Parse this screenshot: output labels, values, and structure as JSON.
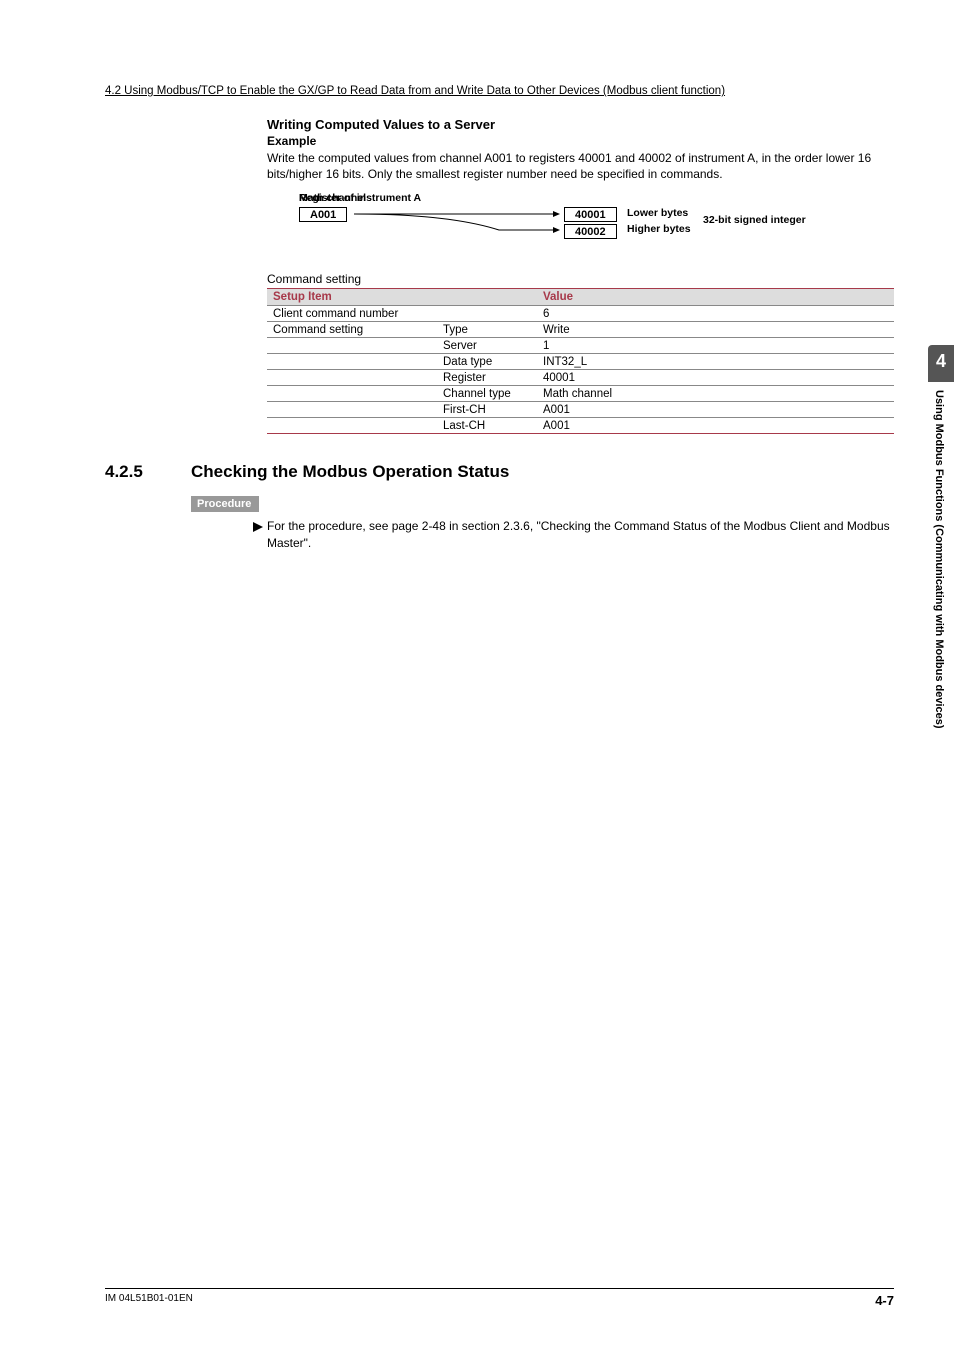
{
  "header_line": "4.2  Using Modbus/TCP to Enable the GX/GP to Read Data from and Write Data to Other Devices (Modbus client function)",
  "sub1": "Writing Computed Values to a Server",
  "sub2": "Example",
  "para": "Write the computed values from channel A001 to registers 40001 and 40002 of instrument A, in the order lower 16 bits/higher 16 bits. Only the smallest register number need be specified in commands.",
  "diagram": {
    "math_label": "Math channel",
    "math_box": "A001",
    "reg_label": "Register of instrument A",
    "reg_box1": "40001",
    "reg_box2": "40002",
    "lower": "Lower bytes",
    "higher": "Higher bytes",
    "int": "32-bit signed integer"
  },
  "table_caption": "Command setting",
  "table_headers": {
    "c1": "Setup Item",
    "c2": "",
    "c3": "Value"
  },
  "rows": [
    {
      "a": "Client command number",
      "b": "",
      "c": "6"
    },
    {
      "a": "Command setting",
      "b": "Type",
      "c": "Write"
    },
    {
      "a": "",
      "b": "Server",
      "c": "1"
    },
    {
      "a": "",
      "b": "Data type",
      "c": "INT32_L"
    },
    {
      "a": "",
      "b": "Register",
      "c": "40001"
    },
    {
      "a": "",
      "b": "Channel type",
      "c": "Math channel"
    },
    {
      "a": "",
      "b": "First-CH",
      "c": "A001"
    },
    {
      "a": "",
      "b": "Last-CH",
      "c": "A001"
    }
  ],
  "section_num": "4.2.5",
  "section_title": "Checking the Modbus Operation Status",
  "procedure_label": "Procedure",
  "procedure_text": "For the procedure, see page 2-48 in section 2.3.6, \"Checking the Command Status of the Modbus Client and Modbus Master\".",
  "side_tab_num": "4",
  "side_tab_text": "Using Modbus Functions (Communicating with Modbus devices)",
  "footer_left": "IM 04L51B01-01EN",
  "footer_right": "4-7",
  "chart_data": {
    "type": "table",
    "title": "Command setting",
    "columns": [
      "Setup Item",
      "",
      "Value"
    ],
    "data": [
      [
        "Client command number",
        "",
        "6"
      ],
      [
        "Command setting",
        "Type",
        "Write"
      ],
      [
        "",
        "Server",
        "1"
      ],
      [
        "",
        "Data type",
        "INT32_L"
      ],
      [
        "",
        "Register",
        "40001"
      ],
      [
        "",
        "Channel type",
        "Math channel"
      ],
      [
        "",
        "First-CH",
        "A001"
      ],
      [
        "",
        "Last-CH",
        "A001"
      ]
    ]
  }
}
